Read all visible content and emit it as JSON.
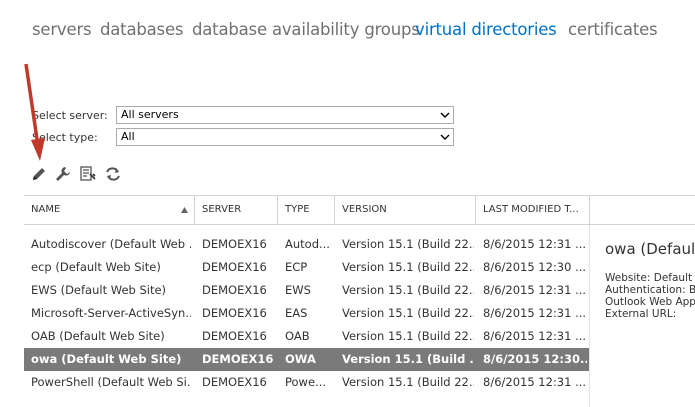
{
  "tabs": [
    {
      "label": "servers",
      "active": false
    },
    {
      "label": "databases",
      "active": false
    },
    {
      "label": "database availability groups",
      "active": false
    },
    {
      "label": "virtual directories",
      "active": true
    },
    {
      "label": "certificates",
      "active": false
    }
  ],
  "filters": {
    "server_label": "Select server:",
    "server_value": "All servers",
    "type_label": "Select type:",
    "type_value": "All"
  },
  "toolbar": {
    "icons": [
      "pencil-icon",
      "wrench-icon",
      "reset-icon",
      "refresh-icon"
    ]
  },
  "table": {
    "columns": [
      "NAME",
      "SERVER",
      "TYPE",
      "VERSION",
      "LAST MODIFIED T..."
    ],
    "rows": [
      {
        "name": "Autodiscover (Default Web ...",
        "server": "DEMOEX16",
        "type": "Autod...",
        "version": "Version 15.1 (Build 22...",
        "modified": "8/6/2015 12:31 ..."
      },
      {
        "name": "ecp (Default Web Site)",
        "server": "DEMOEX16",
        "type": "ECP",
        "version": "Version 15.1 (Build 22...",
        "modified": "8/6/2015 12:30 ..."
      },
      {
        "name": "EWS (Default Web Site)",
        "server": "DEMOEX16",
        "type": "EWS",
        "version": "Version 15.1 (Build 22...",
        "modified": "8/6/2015 12:31 ..."
      },
      {
        "name": "Microsoft-Server-ActiveSyn...",
        "server": "DEMOEX16",
        "type": "EAS",
        "version": "Version 15.1 (Build 22...",
        "modified": "8/6/2015 12:31 ..."
      },
      {
        "name": "OAB (Default Web Site)",
        "server": "DEMOEX16",
        "type": "OAB",
        "version": "Version 15.1 (Build 22...",
        "modified": "8/6/2015 12:31 ..."
      },
      {
        "name": "owa (Default Web Site)",
        "server": "DEMOEX16",
        "type": "OWA",
        "version": "Version 15.1 (Build ...",
        "modified": "8/6/2015 12:30...",
        "selected": true
      },
      {
        "name": "PowerShell (Default Web Si...",
        "server": "DEMOEX16",
        "type": "Powe...",
        "version": "Version 15.1 (Build 22...",
        "modified": "8/6/2015 12:31 ..."
      }
    ]
  },
  "detail": {
    "title": "owa (Defaul",
    "lines": [
      "Website: Default",
      "Authentication: B",
      "Outlook Web App",
      "External URL:"
    ]
  },
  "colors": {
    "accent": "#0072c6",
    "selected_row": "#7a7a7a",
    "arrow": "#c0392b"
  }
}
